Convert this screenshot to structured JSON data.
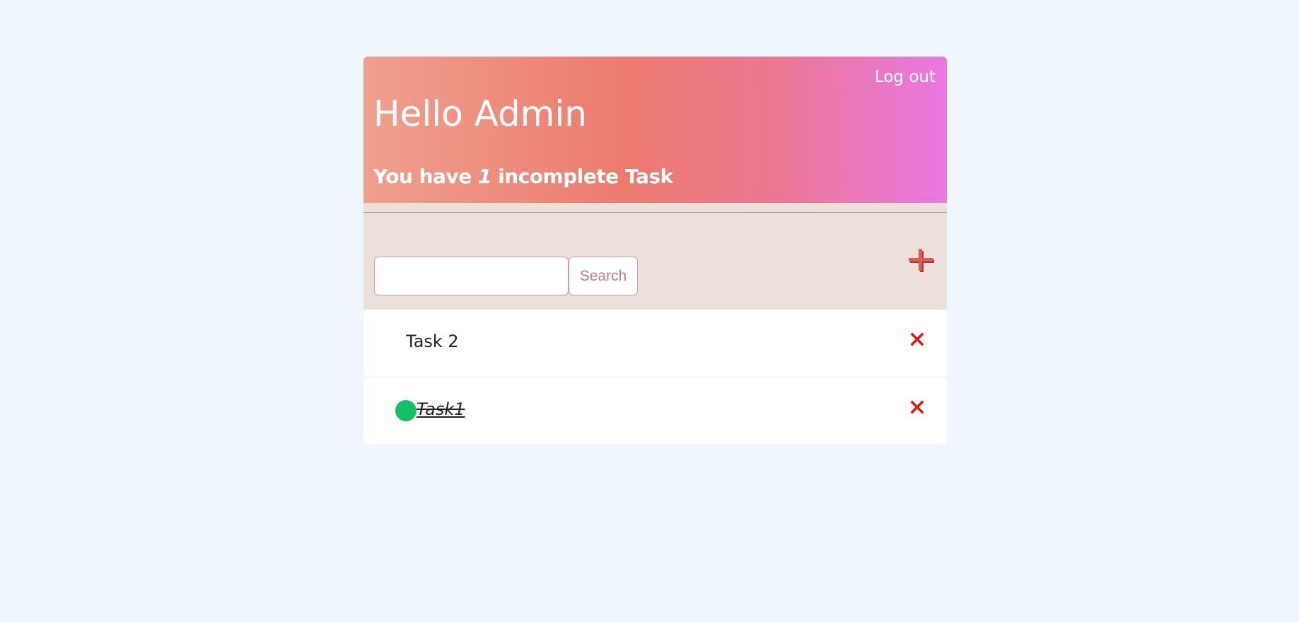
{
  "header": {
    "logout_label": "Log out",
    "greeting": "Hello Admin",
    "summary_prefix": "You have",
    "incomplete_count": "1",
    "summary_suffix": "incomplete Task"
  },
  "toolbar": {
    "search_value": "",
    "search_label": "Search",
    "add_icon": "plus-icon"
  },
  "tasks": [
    {
      "label": "Task 2",
      "completed": false
    },
    {
      "label": "Task1",
      "completed": true
    }
  ],
  "colors": {
    "background": "#eff6fd",
    "header_gradient_start": "#efa08e",
    "header_gradient_end": "#ea78e2",
    "toolbar_bg": "#ece1da",
    "complete_indicator": "#14c066",
    "delete": "#e8120e",
    "add": "#e05a55"
  }
}
